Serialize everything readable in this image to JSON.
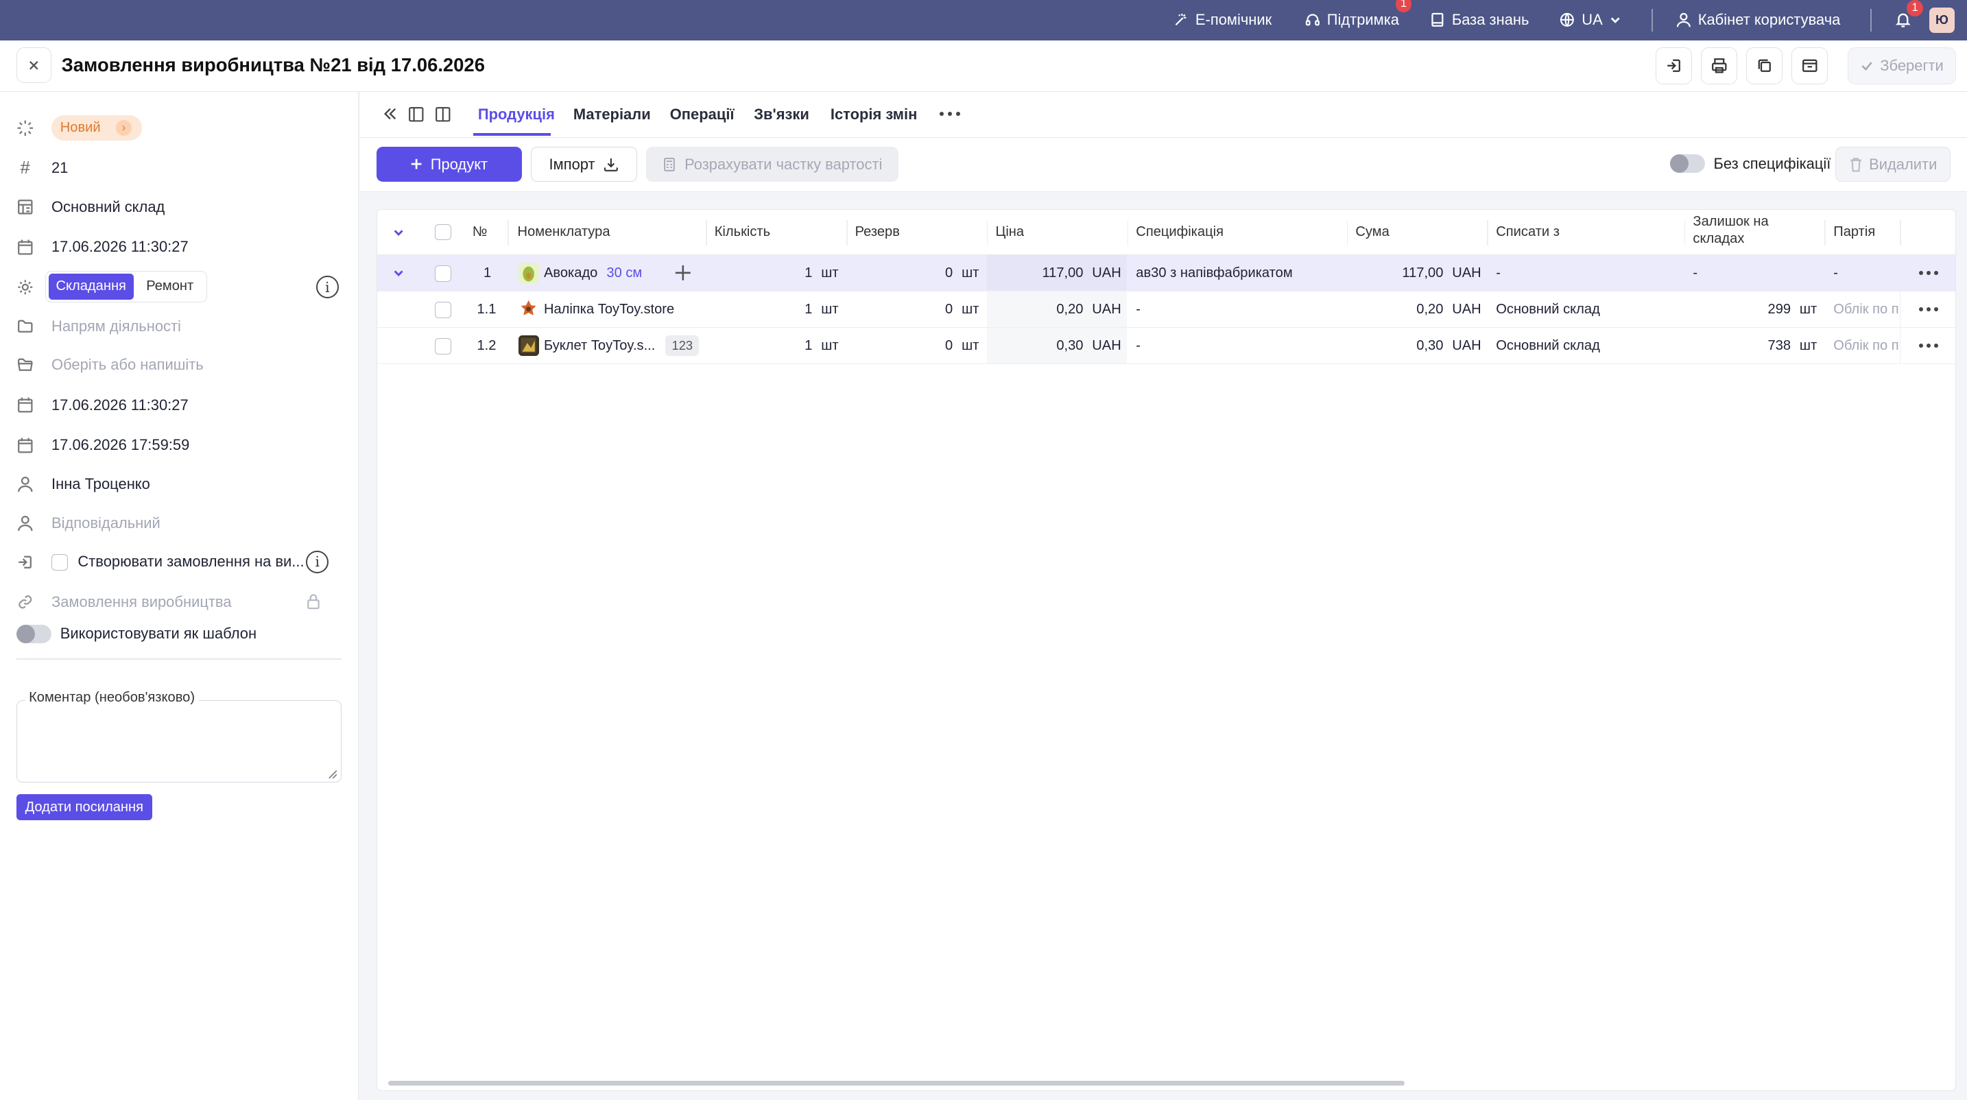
{
  "topbar": {
    "assistant": "Е-помічник",
    "support": "Підтримка",
    "support_badge": "1",
    "knowledge": "База знань",
    "lang": "UA",
    "account": "Кабінет користувача",
    "notif_badge": "1",
    "avatar": "Ю"
  },
  "header": {
    "title": "Замовлення виробництва №21 від 17.06.2026",
    "save": "Зберегти"
  },
  "sidebar": {
    "status": "Новий",
    "number": "21",
    "warehouse": "Основний склад",
    "date": "17.06.2026 11:30:27",
    "type_on": "Складання",
    "type_off": "Ремонт",
    "direction_ph": "Напрям діяльності",
    "choose_ph": "Оберіть або напишіть",
    "date_start": "17.06.2026 11:30:27",
    "date_end": "17.06.2026 17:59:59",
    "author": "Інна Троценко",
    "responsible_ph": "Відповідальний",
    "create_orders": "Створювати замовлення на ви...",
    "prod_order_ph": "Замовлення виробництва",
    "use_template": "Використовувати як шаблон",
    "comment_label": "Коментар (необов'язково)",
    "add_link": "Додати посилання"
  },
  "tabs": [
    "Продукція",
    "Матеріали",
    "Операції",
    "Зв'язки",
    "Історія змін"
  ],
  "toolbar": {
    "add_product": "Продукт",
    "import": "Імпорт",
    "calc_cost": "Розрахувати частку вартості",
    "no_spec": "Без специфікації",
    "delete": "Видалити"
  },
  "table": {
    "headers": {
      "num": "№",
      "nomenclature": "Номенклатура",
      "qty": "Кількість",
      "reserve": "Резерв",
      "price": "Ціна",
      "spec": "Специфікація",
      "sum": "Сума",
      "writeoff": "Списати з",
      "stock1": "Залишок на",
      "stock2": "складах",
      "batch": "Партія"
    },
    "rows": [
      {
        "num": "1",
        "name": "Авокадо",
        "variant": "30 см",
        "tag": "",
        "qty": "1",
        "qty_unit": "шт",
        "reserve": "0",
        "reserve_unit": "шт",
        "price": "117,00",
        "price_cur": "UAH",
        "spec": "ав30 з напівфабрикатом",
        "sum": "117,00",
        "sum_cur": "UAH",
        "writeoff": "-",
        "stock": "-",
        "stock_unit": "",
        "batch": "-"
      },
      {
        "num": "1.1",
        "name": "Наліпка ToyToy.store",
        "variant": "",
        "tag": "",
        "qty": "1",
        "qty_unit": "шт",
        "reserve": "0",
        "reserve_unit": "шт",
        "price": "0,20",
        "price_cur": "UAH",
        "spec": "-",
        "sum": "0,20",
        "sum_cur": "UAH",
        "writeoff": "Основний склад",
        "stock": "299",
        "stock_unit": "шт",
        "batch": "Облік по п"
      },
      {
        "num": "1.2",
        "name": "Буклет ToyToy.s...",
        "variant": "",
        "tag": "123",
        "qty": "1",
        "qty_unit": "шт",
        "reserve": "0",
        "reserve_unit": "шт",
        "price": "0,30",
        "price_cur": "UAH",
        "spec": "-",
        "sum": "0,30",
        "sum_cur": "UAH",
        "writeoff": "Основний склад",
        "stock": "738",
        "stock_unit": "шт",
        "batch": "Облік по п"
      }
    ]
  },
  "colors": {
    "topbar": "#4d5687",
    "accent": "#5b4ee6",
    "status_bg": "#fde7d6",
    "status_text": "#e07a2f",
    "badge": "#e5484d"
  }
}
